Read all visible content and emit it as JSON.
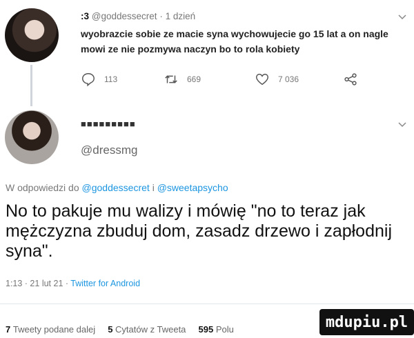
{
  "tweet1": {
    "name": ":3",
    "handle": "@goddessecret",
    "time": "1 dzień",
    "text": "wyobrazcie sobie ze macie syna wychowujecie go 15 lat a on nagle mowi ze nie pozmywa naczyn bo to rola kobiety",
    "replies": "113",
    "retweets": "669",
    "likes": "7 036"
  },
  "tweet2": {
    "name": "■■■■■■■■■",
    "handle": "@dressmg",
    "reply_prefix": "W odpowiedzi do",
    "reply_mention1": "@goddessecret",
    "reply_and": "i",
    "reply_mention2": "@sweetapsycho",
    "text": "No to pakuje mu walizy i mówię \"no to teraz jak mężczyzna zbuduj dom, zasadz drzewo i zapłodnij syna\".",
    "time": "1:13 · 21 lut 21 ·",
    "client": "Twitter for Android"
  },
  "stats": {
    "retweets_count": "7",
    "retweets_label": "Tweety podane dalej",
    "quotes_count": "5",
    "quotes_label": "Cytatów z Tweeta",
    "likes_count": "595",
    "likes_label": "Polu"
  },
  "watermark": "mdupiu.pl",
  "colors": {
    "accent": "#1b95e0",
    "muted": "#777777"
  }
}
